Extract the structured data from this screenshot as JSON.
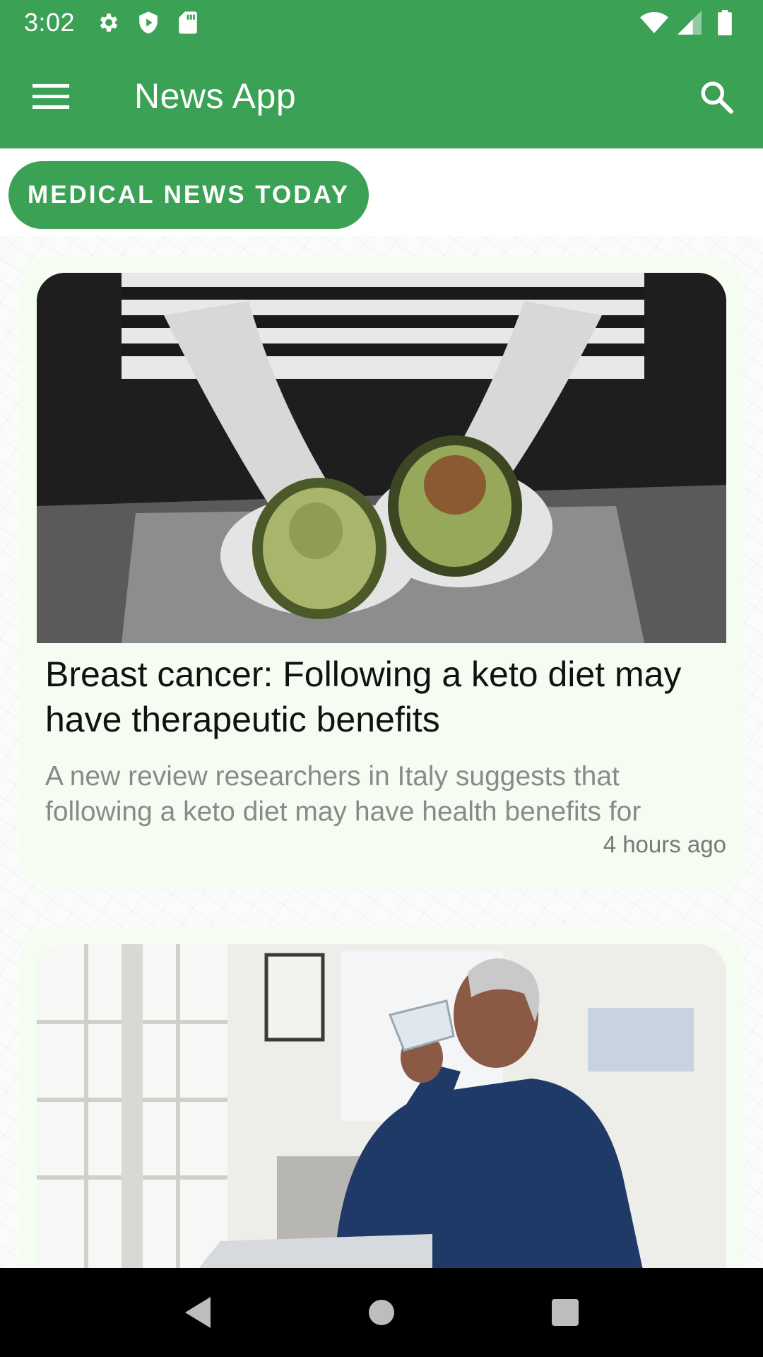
{
  "status_bar": {
    "time": "3:02",
    "icons_left": [
      "settings-icon",
      "shield-icon",
      "sd-card-icon"
    ],
    "icons_right": [
      "wifi-icon",
      "signal-icon",
      "battery-icon"
    ]
  },
  "app_bar": {
    "title": "News App",
    "menu_icon": "hamburger-menu-icon",
    "search_icon": "search-icon"
  },
  "source_chip": {
    "label": "MEDICAL NEWS TODAY"
  },
  "articles": [
    {
      "image": "avocado-halves-photo",
      "title": "Breast cancer: Following a keto diet may have therapeutic benefits",
      "description": "A new review researchers in Italy suggests that following a keto diet may have health benefits for",
      "time": "4 hours ago"
    },
    {
      "image": "man-drinking-water-photo"
    }
  ],
  "nav_bar": {
    "buttons": [
      "back-icon",
      "home-icon",
      "recents-icon"
    ]
  },
  "colors": {
    "primary": "#3aa155",
    "card_background": "#f5fdf3",
    "title_text": "#111111",
    "description_text": "#8a8a8a"
  }
}
